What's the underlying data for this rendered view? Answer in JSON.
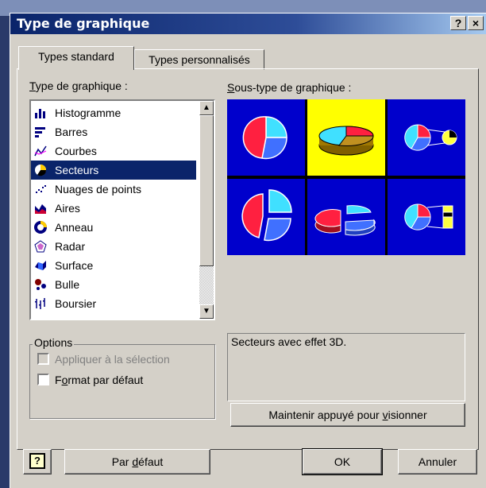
{
  "window": {
    "title": "Type de graphique",
    "help_button": "?",
    "close_button": "×"
  },
  "tabs": [
    {
      "label": "Types standard",
      "active": true
    },
    {
      "label": "Types personnalisés",
      "active": false
    }
  ],
  "chart_type_list": {
    "label": "Type de graphique :",
    "items": [
      {
        "label": "Histogramme",
        "icon": "column-chart-icon"
      },
      {
        "label": "Barres",
        "icon": "bar-chart-icon"
      },
      {
        "label": "Courbes",
        "icon": "line-chart-icon"
      },
      {
        "label": "Secteurs",
        "icon": "pie-chart-icon",
        "selected": true
      },
      {
        "label": "Nuages de points",
        "icon": "scatter-chart-icon"
      },
      {
        "label": "Aires",
        "icon": "area-chart-icon"
      },
      {
        "label": "Anneau",
        "icon": "doughnut-chart-icon"
      },
      {
        "label": "Radar",
        "icon": "radar-chart-icon"
      },
      {
        "label": "Surface",
        "icon": "surface-chart-icon"
      },
      {
        "label": "Bulle",
        "icon": "bubble-chart-icon"
      },
      {
        "label": "Boursier",
        "icon": "stock-chart-icon"
      }
    ]
  },
  "subtype": {
    "label": "Sous-type de graphique :",
    "selected_index": 1,
    "description": "Secteurs avec effet 3D."
  },
  "options": {
    "legend": "Options",
    "apply_to_selection": {
      "label": "Appliquer à la sélection",
      "checked": false,
      "disabled": true
    },
    "default_format": {
      "label": "Format par défaut",
      "checked": false
    }
  },
  "buttons": {
    "preview": "Maintenir appuyé pour visionner",
    "help": "?",
    "set_default": "Par défaut",
    "ok": "OK",
    "cancel": "Annuler"
  },
  "colors": {
    "title_bar": "#0a246a",
    "selection": "#0a246a",
    "subtype_bg": "#0000cc",
    "subtype_selected_bg": "#ffff00",
    "slice_red": "#ff2040",
    "slice_cyan": "#40e0ff",
    "slice_blue": "#4070ff"
  }
}
